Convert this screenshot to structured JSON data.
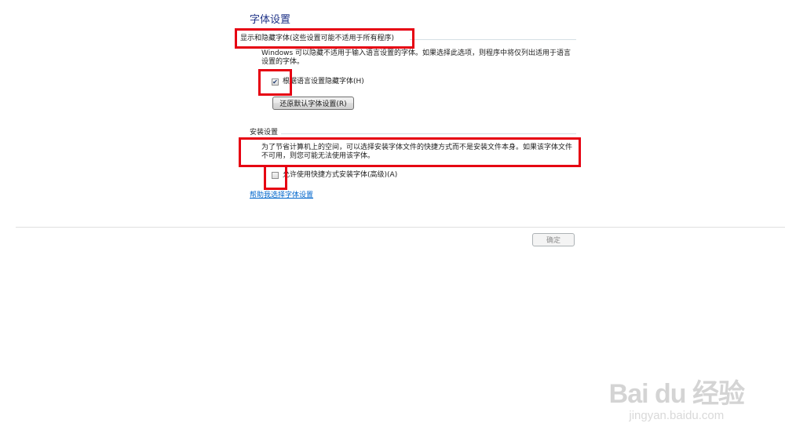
{
  "page": {
    "title": "字体设置"
  },
  "show_hide": {
    "header": "显示和隐藏字体(这些设置可能不适用于所有程序)",
    "description": "Windows 可以隐藏不适用于输入语言设置的字体。如果选择此选项，则程序中将仅列出适用于语言设置的字体。",
    "checkbox_label": "根据语言设置隐藏字体(H)",
    "checkbox_checked": true,
    "restore_button_label": "还原默认字体设置(R)"
  },
  "install": {
    "header": "安装设置",
    "description": "为了节省计算机上的空间，可以选择安装字体文件的快捷方式而不是安装文件本身。如果该字体文件不可用，则您可能无法使用该字体。",
    "checkbox_label": "允许使用快捷方式安装字体(高级)(A)",
    "checkbox_checked": false
  },
  "help_link": "帮助我选择字体设置",
  "footer": {
    "ok_button_label": "确定",
    "ok_enabled": false
  },
  "watermark": {
    "brand": "Bai du 经验",
    "url": "jingyan.baidu.com"
  },
  "colors": {
    "title": "#1e3287",
    "link": "#0066cc",
    "annotation": "#e60012",
    "watermark": "#d4d4d4"
  }
}
